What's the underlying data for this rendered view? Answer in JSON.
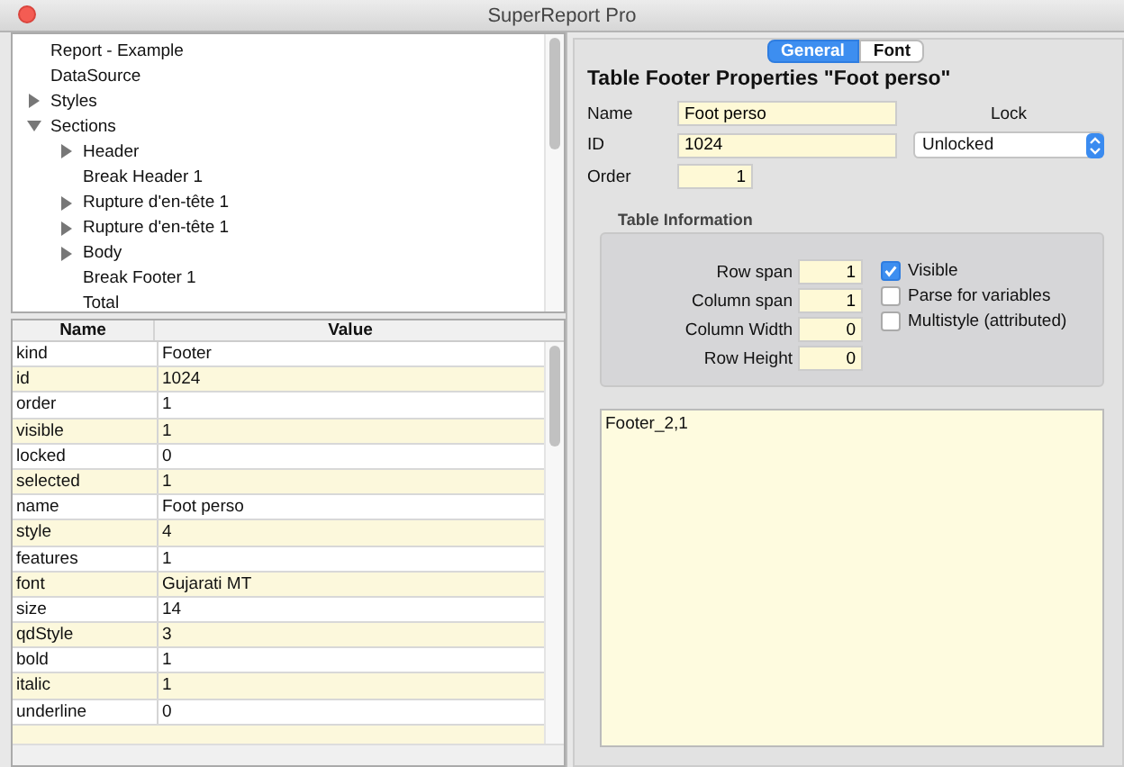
{
  "window": {
    "title": "SuperReport Pro"
  },
  "tree": [
    {
      "label": "Report - Example",
      "kind": "leaf"
    },
    {
      "label": "DataSource",
      "kind": "leaf"
    },
    {
      "label": "Styles",
      "kind": "group",
      "expanded": false
    },
    {
      "label": "Sections",
      "kind": "group",
      "expanded": true,
      "children": [
        {
          "label": "Header",
          "kind": "group",
          "expanded": false
        },
        {
          "label": "Break Header 1",
          "kind": "leaf"
        },
        {
          "label": "Rupture d'en-tête 1",
          "kind": "group",
          "expanded": false
        },
        {
          "label": "Rupture d'en-tête 1",
          "kind": "group",
          "expanded": false
        },
        {
          "label": "Body",
          "kind": "group",
          "expanded": false
        },
        {
          "label": "Break Footer 1",
          "kind": "leaf"
        },
        {
          "label": "Total",
          "kind": "leaf"
        }
      ]
    }
  ],
  "table": {
    "columns": [
      "Name",
      "Value"
    ],
    "rows": [
      [
        "kind",
        "Footer"
      ],
      [
        "id",
        "1024"
      ],
      [
        "order",
        "1"
      ],
      [
        "visible",
        "1"
      ],
      [
        "locked",
        "0"
      ],
      [
        "selected",
        "1"
      ],
      [
        "name",
        "Foot perso"
      ],
      [
        "style",
        "4"
      ],
      [
        "features",
        "1"
      ],
      [
        "font",
        "Gujarati MT"
      ],
      [
        "size",
        "14"
      ],
      [
        "qdStyle",
        "3"
      ],
      [
        "bold",
        "1"
      ],
      [
        "italic",
        "1"
      ],
      [
        "underline",
        "0"
      ]
    ]
  },
  "tabs": [
    {
      "label": "General",
      "selected": true
    },
    {
      "label": "Font",
      "selected": false
    }
  ],
  "heading": "Table Footer Properties \"Foot perso\"",
  "fields": {
    "name": {
      "label": "Name",
      "value": "Foot perso"
    },
    "id": {
      "label": "ID",
      "value": "1024"
    },
    "order": {
      "label": "Order",
      "value": "1"
    }
  },
  "lock": {
    "label": "Lock",
    "value": "Unlocked"
  },
  "table_information": {
    "title": "Table Information",
    "fields": [
      {
        "label": "Row span",
        "value": "1"
      },
      {
        "label": "Column span",
        "value": "1"
      },
      {
        "label": "Column Width",
        "value": "0"
      },
      {
        "label": "Row Height",
        "value": "0"
      }
    ],
    "checkboxes": [
      {
        "label": "Visible",
        "checked": true
      },
      {
        "label": "Parse for variables",
        "checked": false
      },
      {
        "label": "Multistyle (attributed)",
        "checked": false
      }
    ]
  },
  "text_area": {
    "value": "Footer_2,1"
  }
}
